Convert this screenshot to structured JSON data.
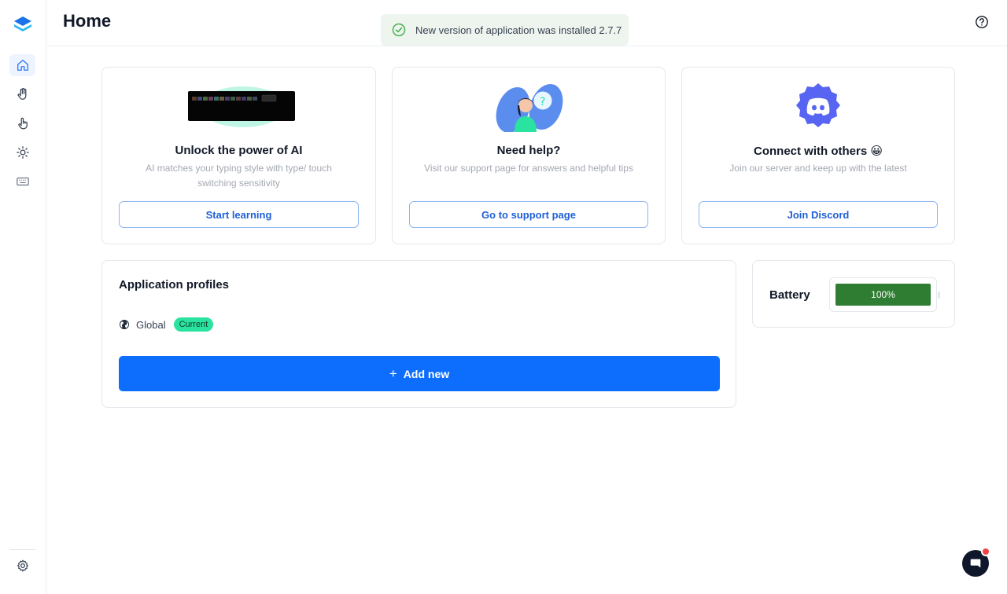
{
  "header": {
    "title": "Home",
    "toast_message": "New version of application was installed 2.7.7"
  },
  "sidebar": {
    "items": [
      {
        "name": "home",
        "icon": "home-icon",
        "active": true
      },
      {
        "name": "gestures",
        "icon": "hand-icon",
        "active": false
      },
      {
        "name": "touch",
        "icon": "touch-icon",
        "active": false
      },
      {
        "name": "lighting",
        "icon": "sun-icon",
        "active": false
      },
      {
        "name": "keyboard",
        "icon": "keyboard-icon",
        "active": false
      }
    ],
    "settings_icon": "gear-icon"
  },
  "cards": [
    {
      "title": "Unlock the power of AI",
      "description": "AI matches your typing style with type/ touch switching sensitivity",
      "button": "Start learning",
      "illustration": "keyboard-illustration"
    },
    {
      "title": "Need help?",
      "description": "Visit our support page for answers and helpful tips",
      "button": "Go to support page",
      "illustration": "support-illustration"
    },
    {
      "title": "Connect with others 😀",
      "description": "Join our server and keep up with the latest",
      "button": "Join Discord",
      "illustration": "discord-logo"
    }
  ],
  "profiles": {
    "title": "Application profiles",
    "items": [
      {
        "name": "Global",
        "badge": "Current"
      }
    ],
    "add_button": "Add new"
  },
  "battery": {
    "label": "Battery",
    "level_text": "100%",
    "level_fraction": 1.0
  },
  "colors": {
    "accent": "#0d6efd",
    "badge": "#2be3a0",
    "battery_fill": "#2e7d32",
    "discord": "#5865f2"
  }
}
